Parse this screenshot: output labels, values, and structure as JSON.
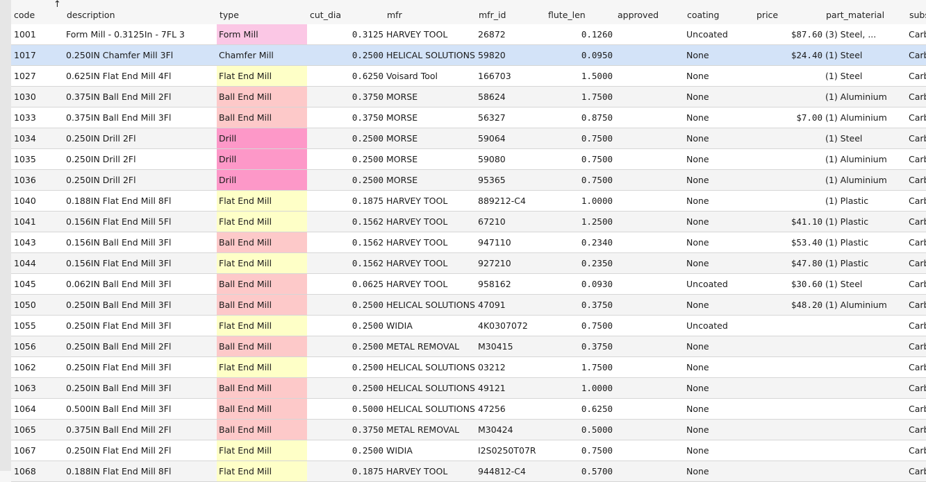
{
  "table": {
    "sorted_column": "code",
    "sort_direction_glyph": "↑",
    "columns": [
      {
        "key": "code",
        "label": "code"
      },
      {
        "key": "description",
        "label": "description"
      },
      {
        "key": "type",
        "label": "type"
      },
      {
        "key": "cut_dia",
        "label": "cut_dia"
      },
      {
        "key": "mfr",
        "label": "mfr"
      },
      {
        "key": "mfr_id",
        "label": "mfr_id"
      },
      {
        "key": "flute_len",
        "label": "flute_len"
      },
      {
        "key": "approved",
        "label": "approved"
      },
      {
        "key": "coating",
        "label": "coating"
      },
      {
        "key": "price",
        "label": "price"
      },
      {
        "key": "part_material",
        "label": "part_material"
      },
      {
        "key": "subs",
        "label": "subs"
      }
    ],
    "type_colors": {
      "Form Mill": "#fbc7e5",
      "Chamfer Mill": "#d3e3f8",
      "Flat End Mill": "#feffc7",
      "Ball End Mill": "#fdc9c9",
      "Drill": "#fd98c8"
    },
    "selected_row_color": "#d3e3f8",
    "rows": [
      {
        "code": "1001",
        "description": "Form Mill - 0.3125In - 7FL 3",
        "type": "Form Mill",
        "cut_dia": "0.3125",
        "mfr": "HARVEY TOOL",
        "mfr_id": "26872",
        "flute_len": "0.1260",
        "approved": "",
        "coating": "Uncoated",
        "price": "$87.60",
        "part_material": "(3) Steel, ...",
        "subs": "Carb"
      },
      {
        "code": "1017",
        "description": "0.250IN Chamfer Mill 3Fl",
        "type": "Chamfer Mill",
        "cut_dia": "0.2500",
        "mfr": "HELICAL SOLUTIONS",
        "mfr_id": "59820",
        "flute_len": "0.0950",
        "approved": "",
        "coating": "None",
        "price": "$24.40",
        "part_material": "(1) Steel",
        "subs": "Carb",
        "selected": true
      },
      {
        "code": "1027",
        "description": "0.625IN Flat End Mill 4Fl",
        "type": "Flat End Mill",
        "cut_dia": "0.6250",
        "mfr": "Voisard Tool",
        "mfr_id": "166703",
        "flute_len": "1.5000",
        "approved": "",
        "coating": "None",
        "price": "",
        "part_material": "(1) Steel",
        "subs": "Carb"
      },
      {
        "code": "1030",
        "description": "0.375IN Ball End Mill 2Fl",
        "type": "Ball End Mill",
        "cut_dia": "0.3750",
        "mfr": "MORSE",
        "mfr_id": "58624",
        "flute_len": "1.7500",
        "approved": "",
        "coating": "None",
        "price": "",
        "part_material": "(1) Aluminium",
        "subs": "Carb"
      },
      {
        "code": "1033",
        "description": "0.375IN Ball End Mill 3Fl",
        "type": "Ball End Mill",
        "cut_dia": "0.3750",
        "mfr": "MORSE",
        "mfr_id": "56327",
        "flute_len": "0.8750",
        "approved": "",
        "coating": "None",
        "price": "$7.00",
        "part_material": "(1) Aluminium",
        "subs": "Carb"
      },
      {
        "code": "1034",
        "description": "0.250IN Drill 2Fl",
        "type": "Drill",
        "cut_dia": "0.2500",
        "mfr": "MORSE",
        "mfr_id": "59064",
        "flute_len": "0.7500",
        "approved": "",
        "coating": "None",
        "price": "",
        "part_material": "(1) Steel",
        "subs": "Carb"
      },
      {
        "code": "1035",
        "description": "0.250IN Drill 2Fl",
        "type": "Drill",
        "cut_dia": "0.2500",
        "mfr": "MORSE",
        "mfr_id": "59080",
        "flute_len": "0.7500",
        "approved": "",
        "coating": "None",
        "price": "",
        "part_material": "(1) Aluminium",
        "subs": "Carb"
      },
      {
        "code": "1036",
        "description": "0.250IN Drill 2Fl",
        "type": "Drill",
        "cut_dia": "0.2500",
        "mfr": "MORSE",
        "mfr_id": "95365",
        "flute_len": "0.7500",
        "approved": "",
        "coating": "None",
        "price": "",
        "part_material": "(1) Aluminium",
        "subs": "Carb"
      },
      {
        "code": "1040",
        "description": "0.188IN Flat End Mill 8Fl",
        "type": "Flat End Mill",
        "cut_dia": "0.1875",
        "mfr": "HARVEY TOOL",
        "mfr_id": "889212-C4",
        "flute_len": "1.0000",
        "approved": "",
        "coating": "None",
        "price": "",
        "part_material": "(1) Plastic",
        "subs": "Carb"
      },
      {
        "code": "1041",
        "description": "0.156IN Flat End Mill 5Fl",
        "type": "Flat End Mill",
        "cut_dia": "0.1562",
        "mfr": "HARVEY TOOL",
        "mfr_id": "67210",
        "flute_len": "1.2500",
        "approved": "",
        "coating": "None",
        "price": "$41.10",
        "part_material": "(1) Plastic",
        "subs": "Carb"
      },
      {
        "code": "1043",
        "description": "0.156IN Ball End Mill 3Fl",
        "type": "Ball End Mill",
        "cut_dia": "0.1562",
        "mfr": "HARVEY TOOL",
        "mfr_id": "947110",
        "flute_len": "0.2340",
        "approved": "",
        "coating": "None",
        "price": "$53.40",
        "part_material": "(1) Plastic",
        "subs": "Carb"
      },
      {
        "code": "1044",
        "description": "0.156IN Flat End Mill 3Fl",
        "type": "Flat End Mill",
        "cut_dia": "0.1562",
        "mfr": "HARVEY TOOL",
        "mfr_id": "927210",
        "flute_len": "0.2350",
        "approved": "",
        "coating": "None",
        "price": "$47.80",
        "part_material": "(1) Plastic",
        "subs": "Carb"
      },
      {
        "code": "1045",
        "description": "0.062IN Ball End Mill 3Fl",
        "type": "Ball End Mill",
        "cut_dia": "0.0625",
        "mfr": "HARVEY TOOL",
        "mfr_id": "958162",
        "flute_len": "0.0930",
        "approved": "",
        "coating": "Uncoated",
        "price": "$30.60",
        "part_material": "(1) Steel",
        "subs": "Carb"
      },
      {
        "code": "1050",
        "description": "0.250IN Ball End Mill 3Fl",
        "type": "Ball End Mill",
        "cut_dia": "0.2500",
        "mfr": "HELICAL SOLUTIONS",
        "mfr_id": "47091",
        "flute_len": "0.3750",
        "approved": "",
        "coating": "None",
        "price": "$48.20",
        "part_material": "(1) Aluminium",
        "subs": "Carb"
      },
      {
        "code": "1055",
        "description": "0.250IN Flat End Mill 3Fl",
        "type": "Flat End Mill",
        "cut_dia": "0.2500",
        "mfr": "WIDIA",
        "mfr_id": "4K0307072",
        "flute_len": "0.7500",
        "approved": "",
        "coating": "Uncoated",
        "price": "",
        "part_material": "",
        "subs": "Carb"
      },
      {
        "code": "1056",
        "description": "0.250IN Ball End Mill 2Fl",
        "type": "Ball End Mill",
        "cut_dia": "0.2500",
        "mfr": "METAL REMOVAL",
        "mfr_id": "M30415",
        "flute_len": "0.3750",
        "approved": "",
        "coating": "None",
        "price": "",
        "part_material": "",
        "subs": "Carb"
      },
      {
        "code": "1062",
        "description": "0.250IN Flat End Mill 3Fl",
        "type": "Flat End Mill",
        "cut_dia": "0.2500",
        "mfr": "HELICAL SOLUTIONS",
        "mfr_id": "03212",
        "flute_len": "1.7500",
        "approved": "",
        "coating": "None",
        "price": "",
        "part_material": "",
        "subs": "Carb"
      },
      {
        "code": "1063",
        "description": "0.250IN Ball End Mill 3Fl",
        "type": "Ball End Mill",
        "cut_dia": "0.2500",
        "mfr": "HELICAL SOLUTIONS",
        "mfr_id": "49121",
        "flute_len": "1.0000",
        "approved": "",
        "coating": "None",
        "price": "",
        "part_material": "",
        "subs": "Carb"
      },
      {
        "code": "1064",
        "description": "0.500IN Ball End Mill 3Fl",
        "type": "Ball End Mill",
        "cut_dia": "0.5000",
        "mfr": "HELICAL SOLUTIONS",
        "mfr_id": "47256",
        "flute_len": "0.6250",
        "approved": "",
        "coating": "None",
        "price": "",
        "part_material": "",
        "subs": "Carb"
      },
      {
        "code": "1065",
        "description": "0.375IN Ball End Mill 2Fl",
        "type": "Ball End Mill",
        "cut_dia": "0.3750",
        "mfr": "METAL REMOVAL",
        "mfr_id": "M30424",
        "flute_len": "0.5000",
        "approved": "",
        "coating": "None",
        "price": "",
        "part_material": "",
        "subs": "Carb"
      },
      {
        "code": "1067",
        "description": "0.250IN Flat End Mill 2Fl",
        "type": "Flat End Mill",
        "cut_dia": "0.2500",
        "mfr": "WIDIA",
        "mfr_id": "I2S0250T07R",
        "flute_len": "0.7500",
        "approved": "",
        "coating": "None",
        "price": "",
        "part_material": "",
        "subs": "Carb"
      },
      {
        "code": "1068",
        "description": "0.188IN Flat End Mill 8Fl",
        "type": "Flat End Mill",
        "cut_dia": "0.1875",
        "mfr": "HARVEY TOOL",
        "mfr_id": "944812-C4",
        "flute_len": "0.5700",
        "approved": "",
        "coating": "None",
        "price": "",
        "part_material": "",
        "subs": "Carb"
      }
    ]
  }
}
